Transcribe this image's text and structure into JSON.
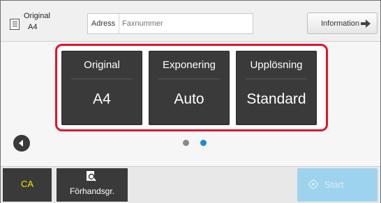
{
  "header": {
    "original_label": "Original",
    "original_size": "A4",
    "address_label": "Adress",
    "address_placeholder": "Faxnummer",
    "info_label": "Information"
  },
  "settings": [
    {
      "title": "Original",
      "value": "A4"
    },
    {
      "title": "Exponering",
      "value": "Auto"
    },
    {
      "title": "Upplösning",
      "value": "Standard"
    }
  ],
  "pager": {
    "page_count": 2,
    "active_page": 2
  },
  "footer": {
    "ca_label": "CA",
    "preview_label": "Förhandsgr.",
    "start_label": "Start"
  },
  "colors": {
    "highlight_border": "#e5122c",
    "card_bg": "#3a3a3a",
    "ca_text": "#f2e600",
    "start_bg": "#9ed3ee",
    "dot_active": "#1a8ad8",
    "dot_inactive": "#8a8a8a"
  },
  "icons": [
    "original-document-icon",
    "arrow-right-icon",
    "back-arrow-icon",
    "preview-magnifier-icon",
    "start-diamond-icon"
  ]
}
